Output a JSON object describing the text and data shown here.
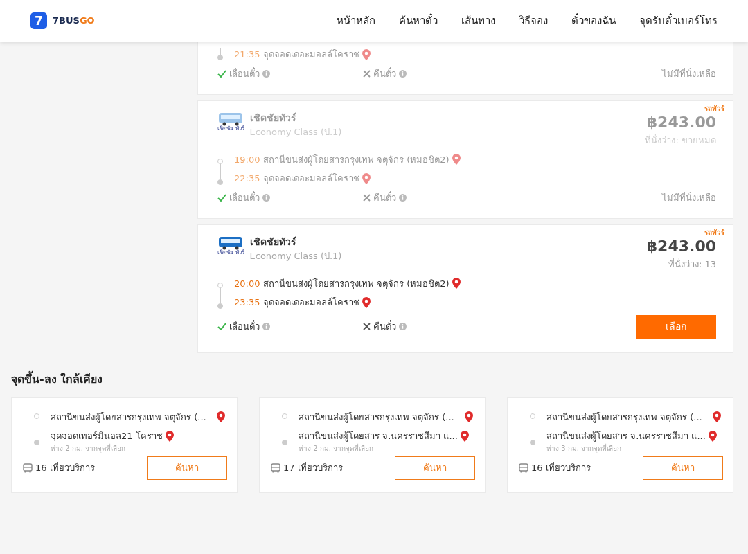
{
  "brand": {
    "mark": "7",
    "name_main": "7BUS",
    "name_accent": "GO"
  },
  "nav": [
    {
      "label": "หน้าหลัก"
    },
    {
      "label": "ค้นหาตั๋ว"
    },
    {
      "label": "เส้นทาง"
    },
    {
      "label": "วิธีจอง"
    },
    {
      "label": "ตั๋วของฉัน"
    },
    {
      "label": "จุดรับตั๋วเบอร์โทร"
    }
  ],
  "trips": [
    {
      "available": false,
      "arrive_time": "21:35",
      "arrive_place": "จุดจอดเดอะมอลล์โคราช",
      "features": [
        {
          "label": "เลื่อนตั๋ว",
          "allowed": true
        },
        {
          "label": "คืนตั๋ว",
          "allowed": false
        }
      ],
      "status": "ไม่มีที่นั่งเหลือ"
    },
    {
      "available": false,
      "badge": "รถทัวร์",
      "logo_text": "เชิดชัย ทัวร์",
      "operator": "เชิดชัยทัวร์",
      "bus_class": "Economy Class (ป.1)",
      "price": "฿243.00",
      "seats": "ที่นั่งว่าง: ขายหมด",
      "depart_time": "19:00",
      "depart_place": "สถานีขนส่งผู้โดยสารกรุงเทพ จตุจักร (หมอชิต2)",
      "arrive_time": "22:35",
      "arrive_place": "จุดจอดเดอะมอลล์โคราช",
      "features": [
        {
          "label": "เลื่อนตั๋ว",
          "allowed": true
        },
        {
          "label": "คืนตั๋ว",
          "allowed": false
        }
      ],
      "status": "ไม่มีที่นั่งเหลือ"
    },
    {
      "available": true,
      "badge": "รถทัวร์",
      "logo_text": "เชิดชัย ทัวร์",
      "operator": "เชิดชัยทัวร์",
      "bus_class": "Economy Class (ป.1)",
      "price": "฿243.00",
      "seats": "ที่นั่งว่าง: 13",
      "depart_time": "20:00",
      "depart_place": "สถานีขนส่งผู้โดยสารกรุงเทพ จตุจักร (หมอชิต2)",
      "arrive_time": "23:35",
      "arrive_place": "จุดจอดเดอะมอลล์โคราช",
      "features": [
        {
          "label": "เลื่อนตั๋ว",
          "allowed": true
        },
        {
          "label": "คืนตั๋ว",
          "allowed": false
        }
      ],
      "select_button": "เลือก"
    }
  ],
  "nearby": {
    "title": "จุดขึ้น-ลง ใกล้เคียง",
    "items": [
      {
        "from": "สถานีขนส่งผู้โดยสารกรุงเทพ จตุจักร (...",
        "to": "จุดจอดเทอร์มินอล21 โคราช",
        "distance": "ห่าง 2 กม. จากจุดที่เลือก",
        "trips": "16 เที่ยวบริการ",
        "button": "ค้นหา"
      },
      {
        "from": "สถานีขนส่งผู้โดยสารกรุงเทพ จตุจักร (...",
        "to": "สถานีขนส่งผู้โดยสาร จ.นครราชสีมา แ...",
        "distance": "ห่าง 2 กม. จากจุดที่เลือก",
        "trips": "17 เที่ยวบริการ",
        "button": "ค้นหา"
      },
      {
        "from": "สถานีขนส่งผู้โดยสารกรุงเทพ จตุจักร (...",
        "to": "สถานีขนส่งผู้โดยสาร จ.นครราชสีมา แ...",
        "distance": "ห่าง 3 กม. จากจุดที่เลือก",
        "trips": "16 เที่ยวบริการ",
        "button": "ค้นหา"
      }
    ]
  }
}
